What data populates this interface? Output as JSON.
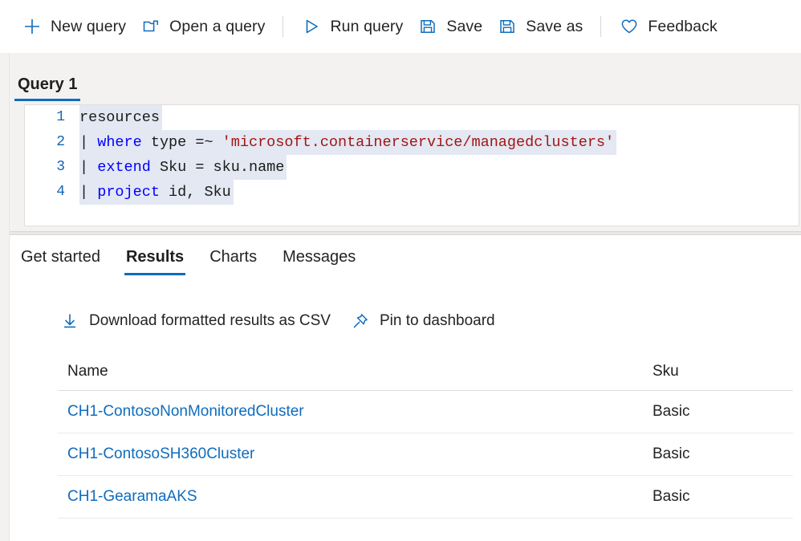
{
  "toolbar": {
    "items": [
      {
        "label": "New query",
        "icon": "plus-icon"
      },
      {
        "label": "Open a query",
        "icon": "folder-open-icon"
      },
      {
        "label": "Run query",
        "icon": "play-triangle-icon"
      },
      {
        "label": "Save",
        "icon": "save-disk-icon"
      },
      {
        "label": "Save as",
        "icon": "save-as-disk-icon"
      },
      {
        "label": "Feedback",
        "icon": "heart-icon"
      }
    ]
  },
  "query_pane": {
    "tab_label": "Query 1",
    "editor": {
      "lines": [
        {
          "number": "1",
          "tokens": [
            {
              "text": "resources",
              "type": "plain"
            }
          ]
        },
        {
          "number": "2",
          "tokens": [
            {
              "text": "| ",
              "type": "pipe"
            },
            {
              "text": "where",
              "type": "kw"
            },
            {
              "text": " type =~ ",
              "type": "plain"
            },
            {
              "text": "'microsoft.containerservice/managedclusters'",
              "type": "str"
            }
          ]
        },
        {
          "number": "3",
          "tokens": [
            {
              "text": "| ",
              "type": "pipe"
            },
            {
              "text": "extend",
              "type": "kw"
            },
            {
              "text": " Sku = sku.name",
              "type": "plain"
            }
          ]
        },
        {
          "number": "4",
          "tokens": [
            {
              "text": "| ",
              "type": "pipe"
            },
            {
              "text": "project",
              "type": "kw"
            },
            {
              "text": " id, Sku",
              "type": "plain"
            }
          ]
        }
      ]
    }
  },
  "results": {
    "tabs": [
      {
        "label": "Get started",
        "active": false
      },
      {
        "label": "Results",
        "active": true
      },
      {
        "label": "Charts",
        "active": false
      },
      {
        "label": "Messages",
        "active": false
      }
    ],
    "actions": [
      {
        "label": "Download formatted results as CSV",
        "icon": "download-arrow-icon"
      },
      {
        "label": "Pin to dashboard",
        "icon": "pin-icon"
      }
    ],
    "table": {
      "columns": [
        "Name",
        "Sku"
      ],
      "rows": [
        {
          "name": "CH1-ContosoNonMonitoredCluster",
          "sku": "Basic"
        },
        {
          "name": "CH1-ContosoSH360Cluster",
          "sku": "Basic"
        },
        {
          "name": "CH1-GearamaAKS",
          "sku": "Basic"
        }
      ]
    }
  },
  "colors": {
    "accent": "#0f6cbd",
    "link": "#0f6cbd",
    "keyword": "#0000ff",
    "string": "#a31515",
    "selection": "#e3e8f2",
    "pane_bg": "#f3f2f1",
    "text": "#242424"
  }
}
